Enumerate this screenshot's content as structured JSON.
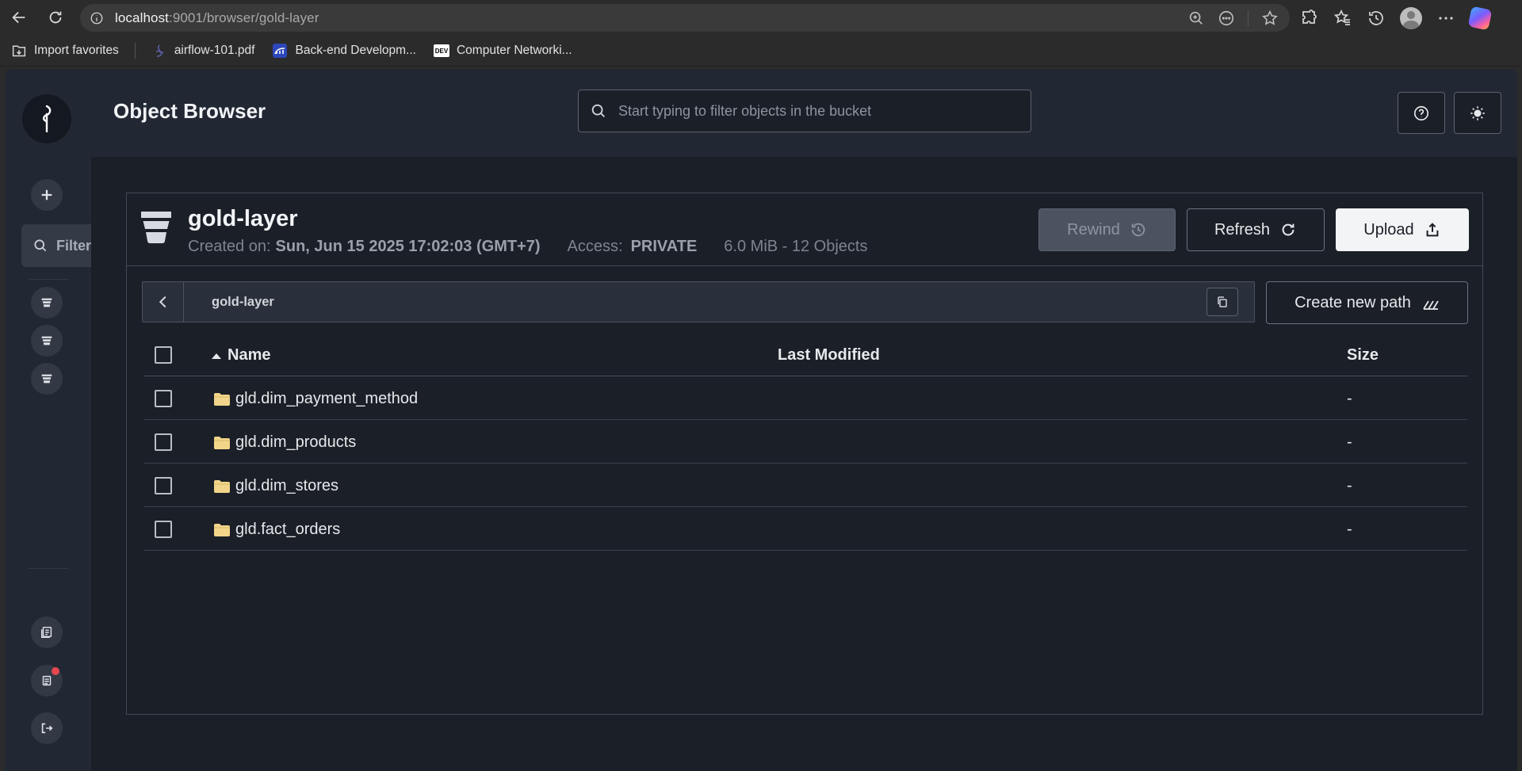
{
  "browser": {
    "url_host": "localhost",
    "url_rest": ":9001/browser/gold-layer",
    "bookmarks": [
      {
        "label": "Import favorites"
      },
      {
        "label": "airflow-101.pdf"
      },
      {
        "label": "Back-end Developm..."
      },
      {
        "label": "Computer Networki..."
      }
    ],
    "dev_badge": "DEV"
  },
  "sidebar": {
    "filter_label": "Filter"
  },
  "header": {
    "title": "Object Browser",
    "search_placeholder": "Start typing to filter objects in the bucket"
  },
  "bucket": {
    "name": "gold-layer",
    "created_label": "Created on:",
    "created_value": "Sun, Jun 15 2025 17:02:03 (GMT+7)",
    "access_label": "Access:",
    "access_value": "PRIVATE",
    "usage": "6.0 MiB - 12 Objects",
    "rewind_label": "Rewind",
    "refresh_label": "Refresh",
    "upload_label": "Upload"
  },
  "path": {
    "current": "gold-layer",
    "create_label": "Create new path"
  },
  "table": {
    "columns": {
      "name": "Name",
      "modified": "Last Modified",
      "size": "Size"
    },
    "rows": [
      {
        "name": "gld.dim_payment_method",
        "modified": "",
        "size": "-"
      },
      {
        "name": "gld.dim_products",
        "modified": "",
        "size": "-"
      },
      {
        "name": "gld.dim_stores",
        "modified": "",
        "size": "-"
      },
      {
        "name": "gld.fact_orders",
        "modified": "",
        "size": "-"
      }
    ]
  },
  "colors": {
    "bg": "#1b1f27",
    "panel": "#222833",
    "folder": "#f2d58a",
    "upload_bg": "#f3f4f6"
  }
}
